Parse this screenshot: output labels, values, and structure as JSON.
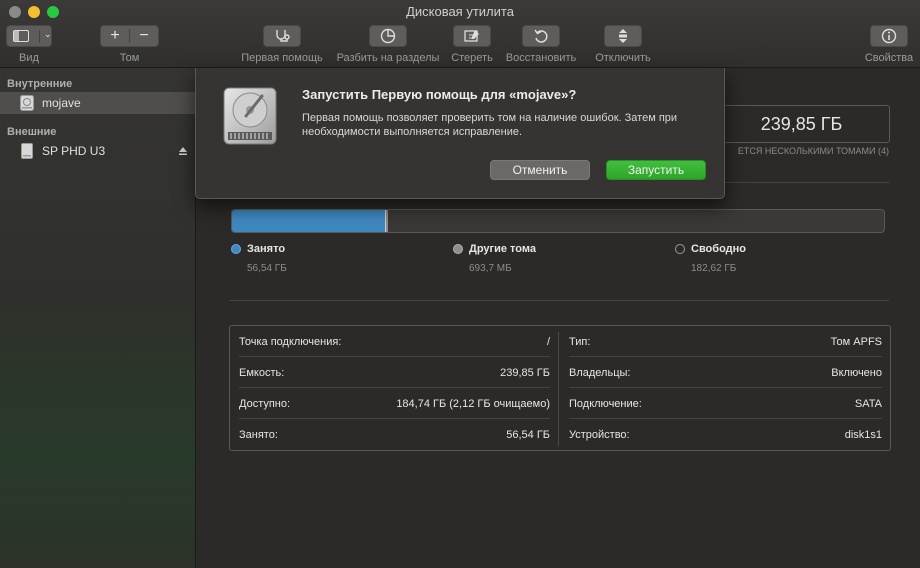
{
  "window": {
    "title": "Дисковая утилита"
  },
  "toolbar": {
    "view_label": "Вид",
    "volume_label": "Том",
    "first_aid_label": "Первая помощь",
    "partition_label": "Разбить на разделы",
    "erase_label": "Стереть",
    "restore_label": "Восстановить",
    "unmount_label": "Отключить",
    "info_label": "Свойства"
  },
  "sidebar": {
    "internal_header": "Внутренние",
    "external_header": "Внешние",
    "internal_items": [
      {
        "label": "mojave",
        "icon": "internal-disk-icon",
        "selected": true
      }
    ],
    "external_items": [
      {
        "label": "SP PHD U3",
        "icon": "external-disk-icon"
      }
    ]
  },
  "volume": {
    "capacity": "239,85 ГБ",
    "shared_note": "ЕТСЯ НЕСКОЛЬКИМИ ТОМАМИ (4)",
    "usage": {
      "used_fraction": 0.236,
      "other_fraction": 0.003,
      "used_color": "#3f89c2",
      "other_color": "#8e8e8e"
    },
    "legend": {
      "used": {
        "label": "Занято",
        "value": "56,54 ГБ"
      },
      "other": {
        "label": "Другие тома",
        "value": "693,7 МБ"
      },
      "free": {
        "label": "Свободно",
        "value": "182,62 ГБ"
      }
    },
    "info_left": [
      {
        "key": "Точка подключения:",
        "value": "/"
      },
      {
        "key": "Емкость:",
        "value": "239,85 ГБ"
      },
      {
        "key": "Доступно:",
        "value": "184,74 ГБ (2,12 ГБ очищаемо)"
      },
      {
        "key": "Занято:",
        "value": "56,54 ГБ"
      }
    ],
    "info_right": [
      {
        "key": "Тип:",
        "value": "Том APFS"
      },
      {
        "key": "Владельцы:",
        "value": "Включено"
      },
      {
        "key": "Подключение:",
        "value": "SATA"
      },
      {
        "key": "Устройство:",
        "value": "disk1s1"
      }
    ]
  },
  "dialog": {
    "title": "Запустить Первую помощь для «mojave»?",
    "message": "Первая помощь позволяет проверить том на наличие ошибок. Затем при необходимости выполняется исправление.",
    "cancel_label": "Отменить",
    "run_label": "Запустить",
    "icon": "hard-drive-icon",
    "run_color": "#2ea52b"
  }
}
